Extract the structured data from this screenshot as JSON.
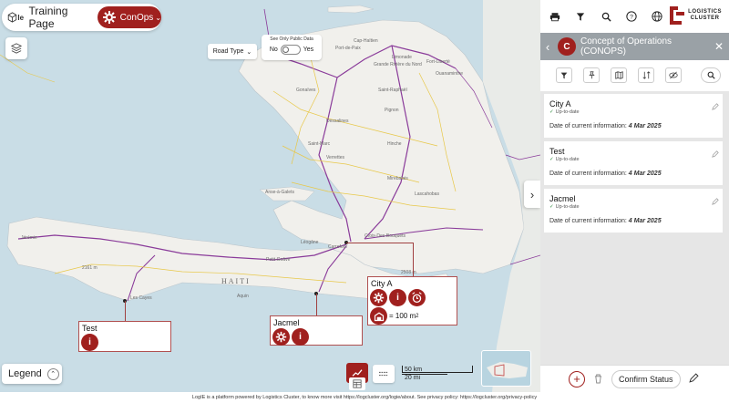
{
  "header": {
    "logo_text": "Ie",
    "page_title": "Training Page",
    "conops_label": "ConOps"
  },
  "map_controls": {
    "road_type": "Road Type",
    "public_title": "See Only Public Data",
    "public_no": "No",
    "public_yes": "Yes",
    "legend": "Legend",
    "scale_km": "50 km",
    "scale_mi": "20 mi"
  },
  "map_labels": {
    "country": "HAITI",
    "cities": [
      "Cap-Haïtien",
      "Port-de-Paix",
      "Gonaïves",
      "Hinche",
      "Saint-Marc",
      "Mirebalais",
      "Léogâne",
      "Jacmel",
      "Les Cayes",
      "Jérémie",
      "Anse-à-Galets",
      "Croix-Des-Bouquets",
      "Carrefour",
      "Petit-Goâve",
      "Aquin",
      "Verrettes",
      "Pignon",
      "Limonade",
      "Ouanaminthe",
      "Fort-Liberté",
      "Dessalines",
      "Grande Rivière du Nord",
      "Saint-Raphaël",
      "Lascahobas"
    ],
    "elevations": [
      "2161 m",
      "2508 m"
    ]
  },
  "callouts": [
    {
      "name": "City A",
      "storage": "= 100 m",
      "storage_sup": "2"
    },
    {
      "name": "Jacmel"
    },
    {
      "name": "Test"
    }
  ],
  "panel": {
    "badge": "C",
    "title": "Concept of Operations (CONOPS)",
    "cards": [
      {
        "name": "City A",
        "status": "Up-to-date",
        "date_label": "Date of current information:",
        "date": "4 Mar 2025"
      },
      {
        "name": "Test",
        "status": "Up-to-date",
        "date_label": "Date of current information:",
        "date": "4 Mar 2025"
      },
      {
        "name": "Jacmel",
        "status": "Up-to-date",
        "date_label": "Date of current information:",
        "date": "4 Mar 2025"
      }
    ],
    "confirm": "Confirm Status"
  },
  "brand": {
    "line1": "LOGISTICS",
    "line2": "CLUSTER"
  },
  "footer": "LogIE is a platform powered by Logistics Cluster, to know more visit https://logcluster.org/logie/about. See privacy policy: https://logcluster.org/privacy-policy",
  "colors": {
    "accent": "#a0201e",
    "panel_header": "#9aa1a6"
  }
}
